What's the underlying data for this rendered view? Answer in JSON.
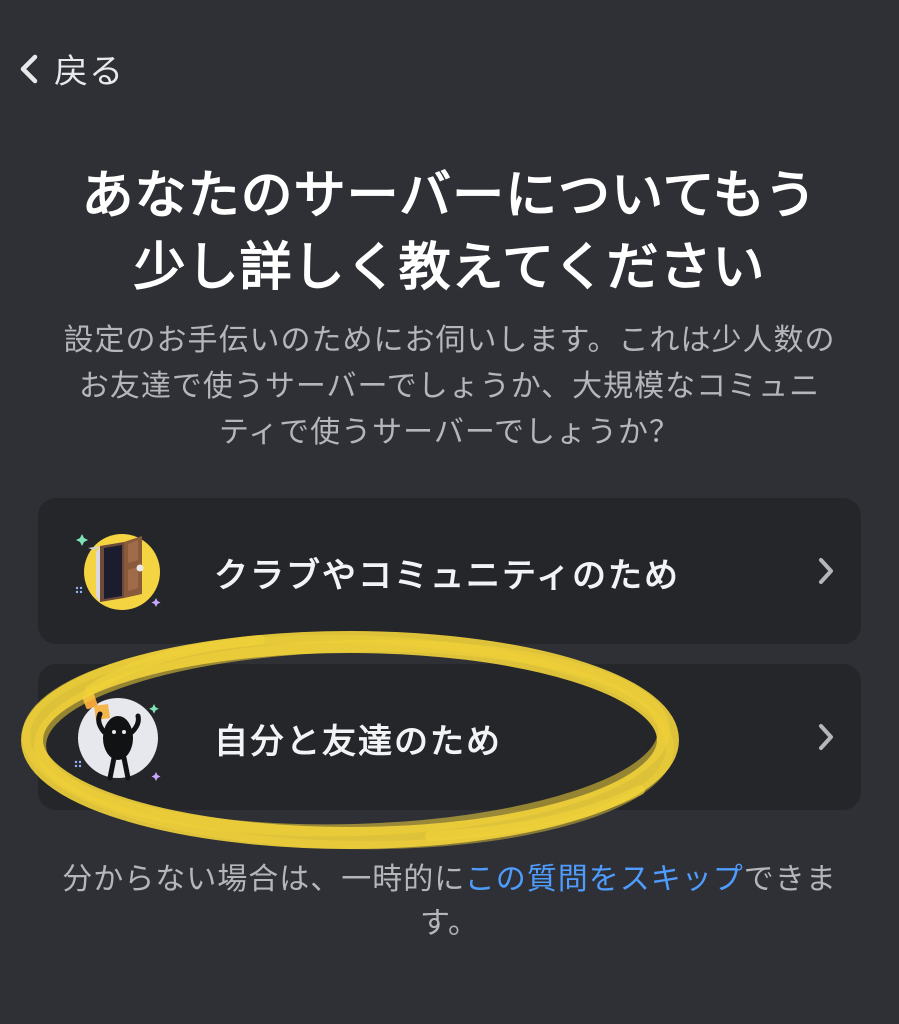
{
  "nav": {
    "back_label": "戻る",
    "back_icon": "chevron-left-icon"
  },
  "header": {
    "title_line1": "あなたのサーバーについてもう",
    "title_line2": "少し詳しく教えてください",
    "subtitle_line1": "設定のお手伝いのためにお伺いします。これは少人数の",
    "subtitle_line2": "お友達で使うサーバーでしょうか、大規模なコミュニ",
    "subtitle_line3": "ティで使うサーバーでしょうか？"
  },
  "options": [
    {
      "label": "クラブやコミュニティのため",
      "icon": "door-icon",
      "chevron": "chevron-right-icon"
    },
    {
      "label": "自分と友達のため",
      "icon": "character-waving-icon",
      "chevron": "chevron-right-icon"
    }
  ],
  "footer": {
    "text_before": "分からない場合は、一時的に",
    "link_text": "この質問をスキップ",
    "text_after_line1": "できま",
    "text_after_line2": "す。"
  },
  "colors": {
    "background": "#2f3035",
    "card": "#25262a",
    "link": "#4f9cff",
    "highlight": "#f2d33a",
    "club_icon_bg": "#f5d442",
    "friends_icon_bg": "#e6e8ee"
  }
}
